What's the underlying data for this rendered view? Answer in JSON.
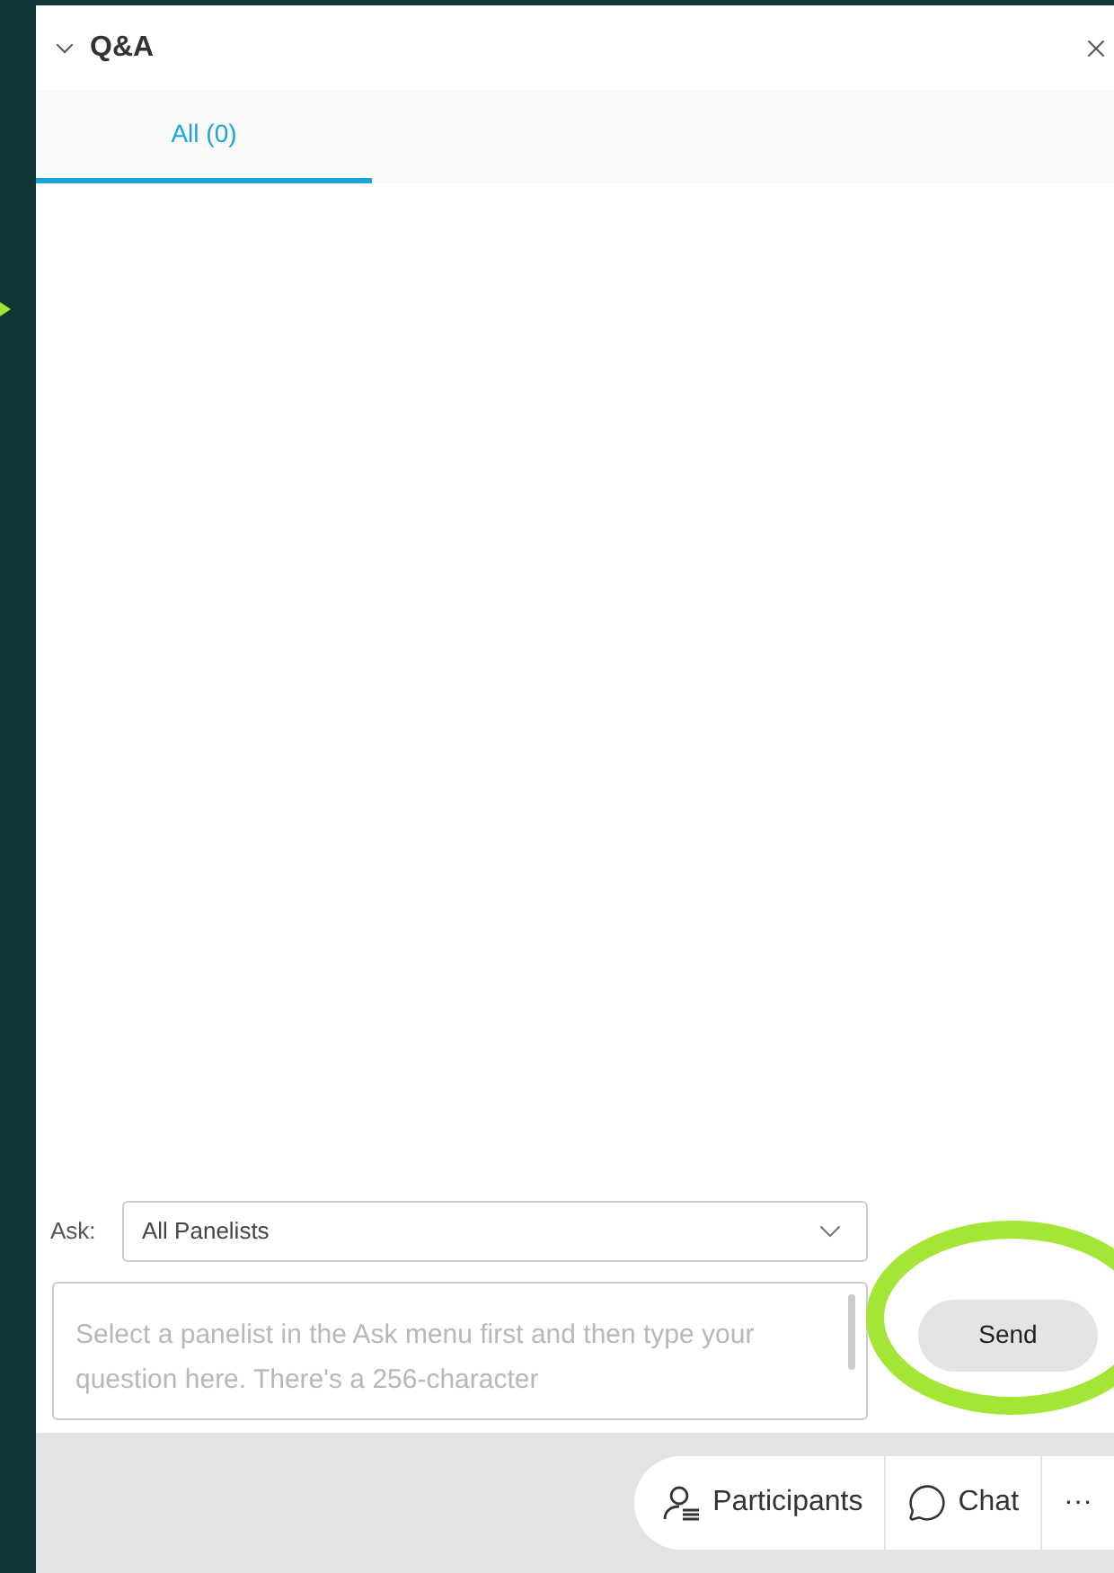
{
  "panel": {
    "title": "Q&A"
  },
  "tabs": [
    {
      "label": "All (0)",
      "selected": true
    }
  ],
  "ask": {
    "label": "Ask:",
    "value": "All Panelists"
  },
  "question": {
    "placeholder": "Select a panelist in the Ask menu first and then type your question here. There's a 256-character"
  },
  "send_button": "Send",
  "footer_buttons": [
    {
      "kind": "participants",
      "label": "Participants"
    },
    {
      "kind": "chat",
      "label": "Chat"
    },
    {
      "kind": "more",
      "label": "···"
    }
  ]
}
